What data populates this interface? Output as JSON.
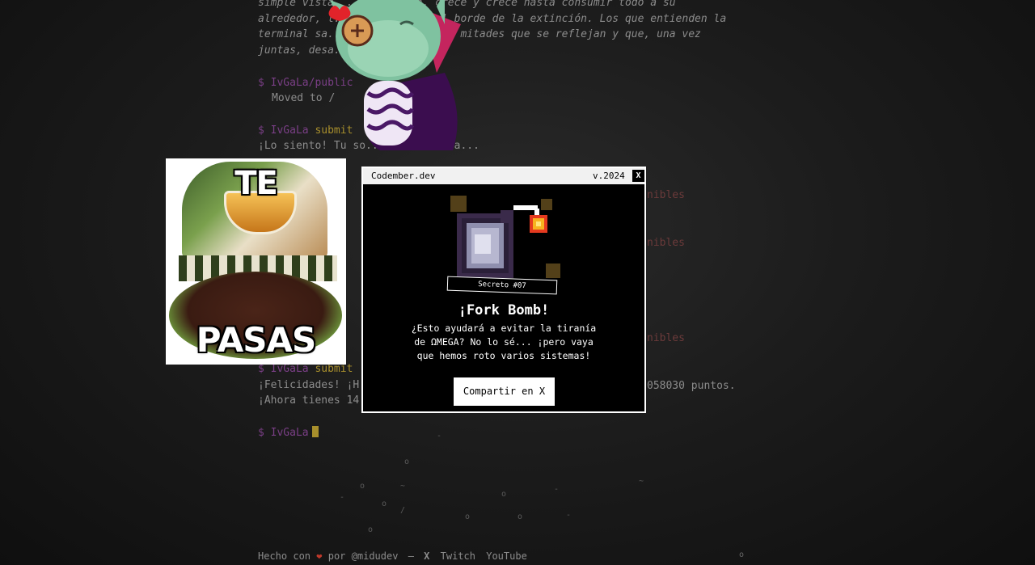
{
  "terminal": {
    "intro_lines": [
      "simple vista, ... e activa, crece y crece hasta consumir todo a su",
      "alrededor, l...          ma al borde de la extinción. Los que entienden la",
      "terminal sa...        o por dos mitades que se reflejan y que, una vez",
      "juntas, desa..."
    ],
    "cmd1_prompt": "$ IvGaLa/public",
    "cmd1_output": "Moved to /",
    "cmd2_prompt": "$ IvGaLa",
    "cmd2_cmd": "submit",
    "cmd2_output": "¡Lo siento! Tu so...      rrecta...",
    "cmd3_prompt": "$ IvGaLa",
    "cmd3_cmd": "submit",
    "congrats_line": "¡Felicidades! ¡H...",
    "points_fragment": "058030 puntos.",
    "now_line": "¡Ahora tienes 14...",
    "final_prompt": "$ IvGaLa",
    "right_fragments": [
      "nibles",
      "nibles",
      "nibles"
    ]
  },
  "sticker": {
    "top_text": "TE",
    "bottom_text": "PASAS"
  },
  "modal": {
    "title": "Codember.dev",
    "version": "v.2024",
    "close_label": "X",
    "secret_label": "Secreto #07",
    "heading": "¡Fork Bomb!",
    "description_lines": [
      "¿Esto ayudará a evitar la tiranía",
      "de ΩMEGA? No lo sé... ¡pero vaya",
      "que hemos roto varios sistemas!"
    ],
    "share_button": "Compartir en X"
  },
  "footer": {
    "made_with": "Hecho con",
    "by": "por",
    "author": "@midudev",
    "separator": "—",
    "x_label": "X",
    "twitch_label": "Twitch",
    "youtube_label": "YouTube"
  },
  "colors": {
    "prompt": "#7a3f86",
    "command": "#a88f2c",
    "heart": "#c0392b",
    "modal_border": "#ffffff"
  }
}
